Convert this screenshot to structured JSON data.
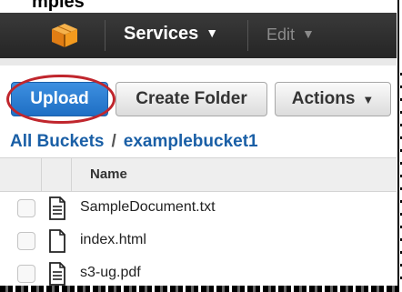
{
  "header_fragment": "mples",
  "nav": {
    "logo_icon": "aws-cube-icon",
    "services_label": "Services",
    "edit_label": "Edit"
  },
  "toolbar": {
    "upload_label": "Upload",
    "create_folder_label": "Create Folder",
    "actions_label": "Actions"
  },
  "breadcrumb": {
    "root": "All Buckets",
    "separator": "/",
    "current": "examplebucket1"
  },
  "table": {
    "column_name": "Name",
    "rows": [
      {
        "name": "SampleDocument.txt",
        "icon": "text-file-icon"
      },
      {
        "name": "index.html",
        "icon": "blank-file-icon"
      },
      {
        "name": "s3-ug.pdf",
        "icon": "text-file-icon"
      }
    ]
  },
  "colors": {
    "navbar": "#2e2e2e",
    "primary": "#2b7bd3",
    "link": "#1a5fa6",
    "highlight_oval": "#c0262d",
    "logo": "#f39a1e"
  }
}
